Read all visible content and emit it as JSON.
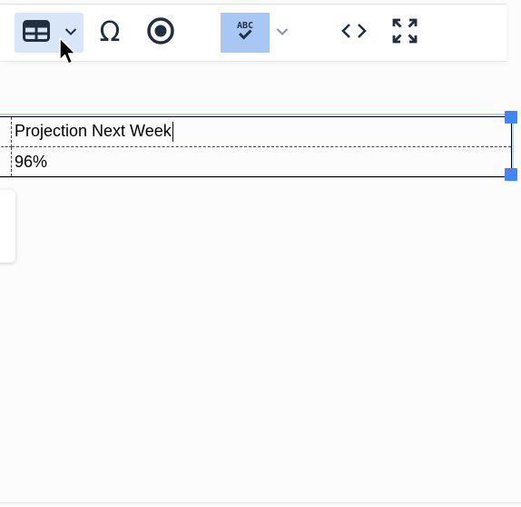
{
  "toolbar": {
    "buttons": [
      {
        "name": "table",
        "icon": "table-icon",
        "active": true,
        "split": true
      },
      {
        "name": "special-character",
        "icon": "omega-icon",
        "glyph": "Ω"
      },
      {
        "name": "anchor",
        "icon": "target-icon"
      },
      {
        "name": "spellchecker",
        "icon": "spellcheck-icon",
        "active": true,
        "split": true
      },
      {
        "name": "source-code",
        "icon": "code-icon"
      },
      {
        "name": "fullscreen",
        "icon": "fullscreen-icon"
      }
    ],
    "active_bg": "#d8e6f8",
    "spell_active_bg": "#a8c7f5",
    "icon_color": "#222f3e"
  },
  "editor": {
    "table": {
      "rows": [
        {
          "cells": [
            "",
            "Projection Next Week"
          ]
        },
        {
          "cells": [
            "",
            "96%"
          ]
        }
      ],
      "selected": true,
      "outline_color": "#b4d7ff",
      "handle_color": "#4285f4"
    }
  }
}
